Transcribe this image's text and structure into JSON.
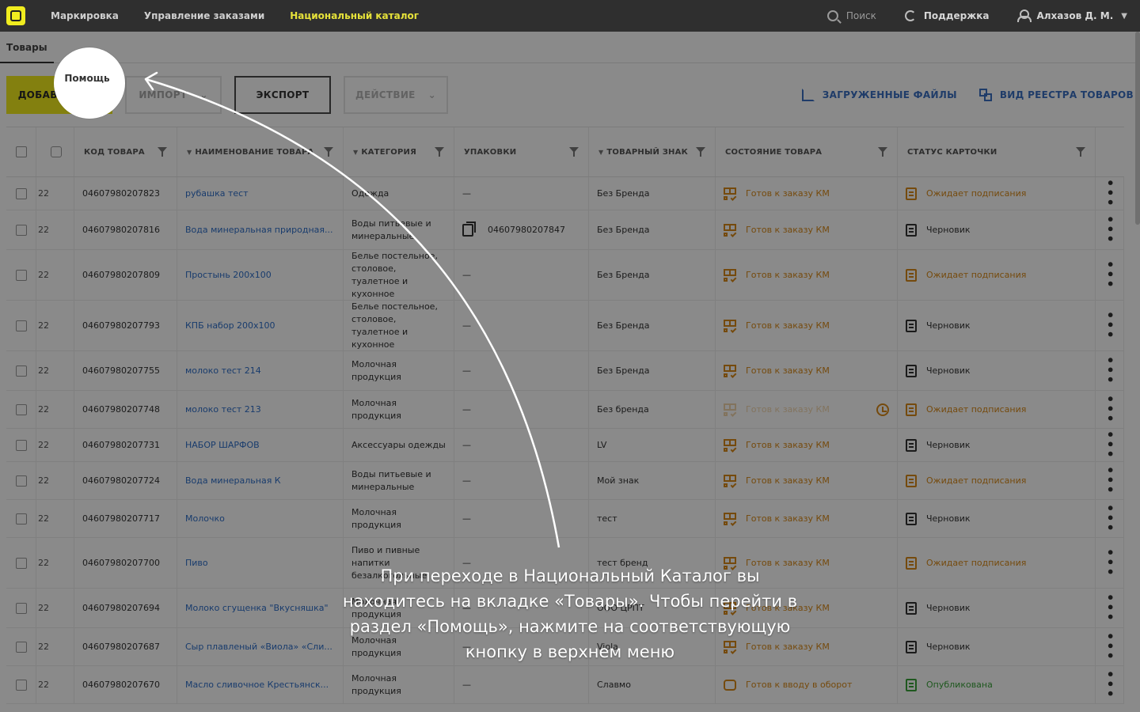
{
  "topbar": {
    "nav": [
      "Маркировка",
      "Управление заказами",
      "Национальный каталог"
    ],
    "search": "Поиск",
    "support": "Поддержка",
    "user": "Алхазов Д. М."
  },
  "subtabs": {
    "goods": "Товары",
    "help": "Помощь"
  },
  "toolbar": {
    "add": "ДОБАВИТЬ",
    "import": "ИМПОРТ",
    "export": "ЭКСПОРТ",
    "action": "ДЕЙСТВИЕ",
    "uploaded": "ЗАГРУЖЕННЫЕ ФАЙЛЫ",
    "registry": "ВИД РЕЕСТРА ТОВАРОВ"
  },
  "columns": {
    "code": "КОД ТОВАРА",
    "name": "НАИМЕНОВАНИЕ ТОВАРА",
    "category": "КАТЕГОРИЯ",
    "pack": "УПАКОВКИ",
    "brand": "ТОВАРНЫЙ ЗНАК",
    "state": "СОСТОЯНИЕ ТОВАРА",
    "status": "СТАТУС КАРТОЧКИ"
  },
  "rows": [
    {
      "id": "22",
      "code": "04607980207823",
      "name": "рубашка тест",
      "category": "Одежда",
      "pack": "—",
      "brand": "Без Бренда",
      "state": "Готов к заказу КМ",
      "status": "Ожидает подписания"
    },
    {
      "id": "22",
      "code": "04607980207816",
      "name": "Вода минеральная природная...",
      "category": "Воды питьевые и минеральные",
      "pack": "04607980207847",
      "brand": "Без Бренда",
      "state": "Готов к заказу КМ",
      "status": "Черновик"
    },
    {
      "id": "22",
      "code": "04607980207809",
      "name": "Простынь 200х100",
      "category": "Белье постельное, столовое, туалетное и кухонное",
      "pack": "—",
      "brand": "Без Бренда",
      "state": "Готов к заказу КМ",
      "status": "Ожидает подписания"
    },
    {
      "id": "22",
      "code": "04607980207793",
      "name": "КПБ набор 200х100",
      "category": "Белье постельное, столовое, туалетное и кухонное",
      "pack": "—",
      "brand": "Без Бренда",
      "state": "Готов к заказу КМ",
      "status": "Черновик"
    },
    {
      "id": "22",
      "code": "04607980207755",
      "name": "молоко тест 214",
      "category": "Молочная продукция",
      "pack": "—",
      "brand": "Без Бренда",
      "state": "Готов к заказу КМ",
      "status": "Черновик"
    },
    {
      "id": "22",
      "code": "04607980207748",
      "name": "молоко тест 213",
      "category": "Молочная продукция",
      "pack": "—",
      "brand": "Без бренда",
      "state": "Готов к заказу КМ",
      "status": "Ожидает подписания"
    },
    {
      "id": "22",
      "code": "04607980207731",
      "name": "НАБОР ШАРФОВ",
      "category": "Аксессуары одежды",
      "pack": "—",
      "brand": "LV",
      "state": "Готов к заказу КМ",
      "status": "Черновик"
    },
    {
      "id": "22",
      "code": "04607980207724",
      "name": "Вода минеральная К",
      "category": "Воды питьевые и минеральные",
      "pack": "—",
      "brand": "Мой знак",
      "state": "Готов к заказу КМ",
      "status": "Ожидает подписания"
    },
    {
      "id": "22",
      "code": "04607980207717",
      "name": "Молочко",
      "category": "Молочная продукция",
      "pack": "—",
      "brand": "тест",
      "state": "Готов к заказу КМ",
      "status": "Черновик"
    },
    {
      "id": "22",
      "code": "04607980207700",
      "name": "Пиво",
      "category": "Пиво и пивные напитки безалкогольные",
      "pack": "—",
      "brand": "тест бренд",
      "state": "Готов к заказу КМ",
      "status": "Ожидает подписания"
    },
    {
      "id": "22",
      "code": "04607980207694",
      "name": "Молоко сгущенка \"Вкусняшка\"",
      "category": "Молочная продукция",
      "pack": "—",
      "brand": "ООО ЦРПТ",
      "state": "Готов к заказу КМ",
      "status": "Черновик"
    },
    {
      "id": "22",
      "code": "04607980207687",
      "name": "Сыр плавленый «Виола» «Сли...",
      "category": "Молочная продукция",
      "pack": "—",
      "brand": "Viola",
      "state": "Готов к заказу КМ",
      "status": "Черновик"
    },
    {
      "id": "22",
      "code": "04607980207670",
      "name": "Масло сливочное Крестьянск...",
      "category": "Молочная продукция",
      "pack": "—",
      "brand": "Славмо",
      "state": "Готов к вводу в оборот",
      "status": "Опубликована"
    }
  ],
  "hint": "При переходе в Национальный Каталог вы находитесь на вкладке «Товары». Чтобы перейти в раздел  «Помощь», нажмите на соответствующую кнопку в верхнем меню"
}
